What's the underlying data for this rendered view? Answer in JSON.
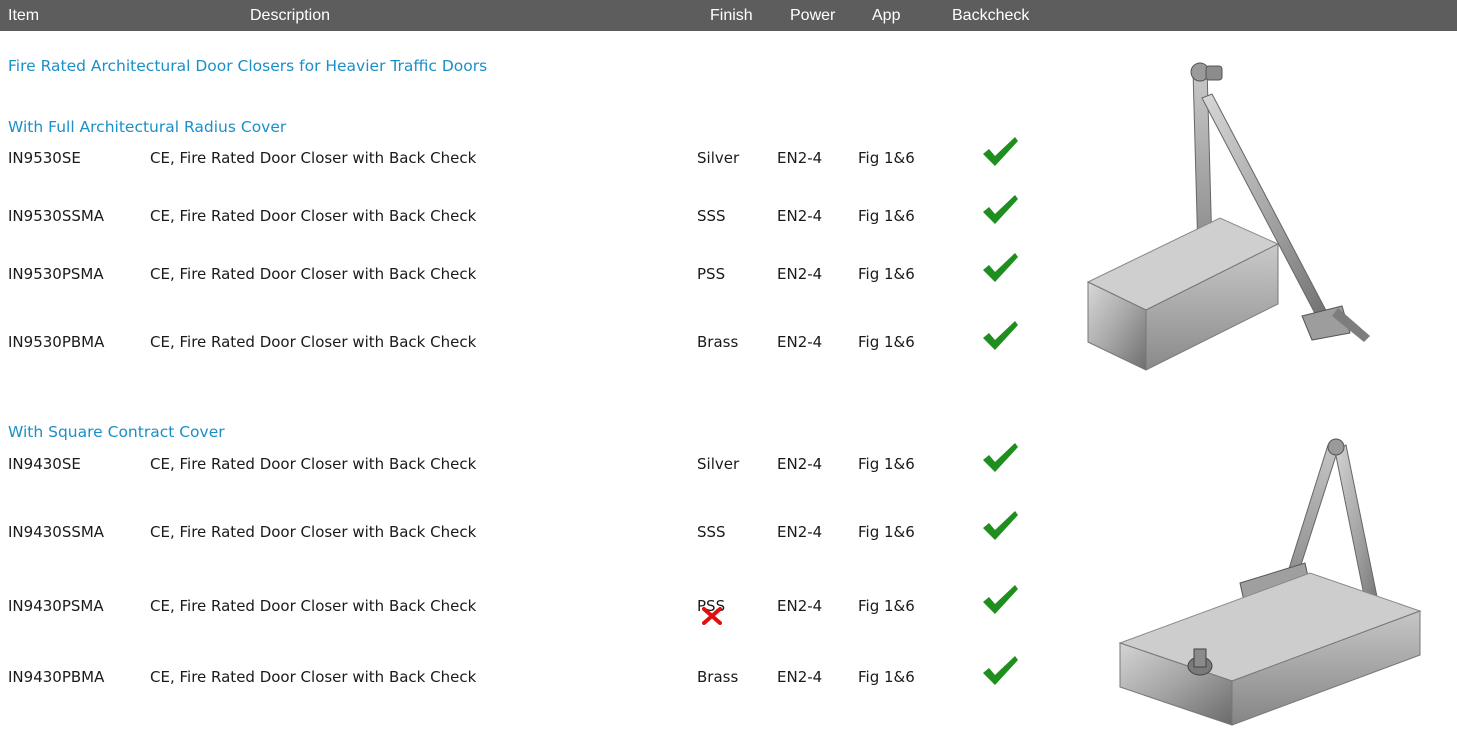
{
  "header": {
    "item": "Item",
    "description": "Description",
    "finish": "Finish",
    "power": "Power",
    "app": "App",
    "backcheck": "Backcheck"
  },
  "title": "Fire Rated Architectural Door Closers for Heavier Traffic Doors",
  "sections": [
    {
      "title": "With Full Architectural Radius Cover",
      "rows": [
        {
          "item": "IN9530SE",
          "description": "CE, Fire Rated Door Closer with Back Check",
          "finish": "Silver",
          "power": "EN2-4",
          "app": "Fig 1&6"
        },
        {
          "item": "IN9530SSMA",
          "description": "CE, Fire Rated Door Closer with Back Check",
          "finish": "SSS",
          "power": "EN2-4",
          "app": "Fig 1&6"
        },
        {
          "item": "IN9530PSMA",
          "description": "CE, Fire Rated Door Closer with Back Check",
          "finish": "PSS",
          "power": "EN2-4",
          "app": "Fig 1&6"
        },
        {
          "item": "IN9530PBMA",
          "description": "CE, Fire Rated Door Closer with Back Check",
          "finish": "Brass",
          "power": "EN2-4",
          "app": "Fig 1&6"
        }
      ]
    },
    {
      "title": "With Square Contract Cover",
      "rows": [
        {
          "item": "IN9430SE",
          "description": "CE, Fire Rated Door Closer with Back Check",
          "finish": "Silver",
          "power": "EN2-4",
          "app": "Fig 1&6"
        },
        {
          "item": "IN9430SSMA",
          "description": "CE, Fire Rated Door Closer with Back Check",
          "finish": "SSS",
          "power": "EN2-4",
          "app": "Fig 1&6"
        },
        {
          "item": "IN9430PSMA",
          "description": "CE, Fire Rated Door Closer with Back Check",
          "finish": "PSS",
          "power": "EN2-4",
          "app": "Fig 1&6"
        },
        {
          "item": "IN9430PBMA",
          "description": "CE, Fire Rated Door Closer with Back Check",
          "finish": "Brass",
          "power": "EN2-4",
          "app": "Fig 1&6"
        }
      ]
    }
  ],
  "icons": {
    "backcheck": "check-icon",
    "mark": "cross-icon"
  },
  "colors": {
    "header_bg": "#5d5d5d",
    "accent": "#1b8fc8",
    "check": "#1e8f1e",
    "cross": "#e01010"
  }
}
